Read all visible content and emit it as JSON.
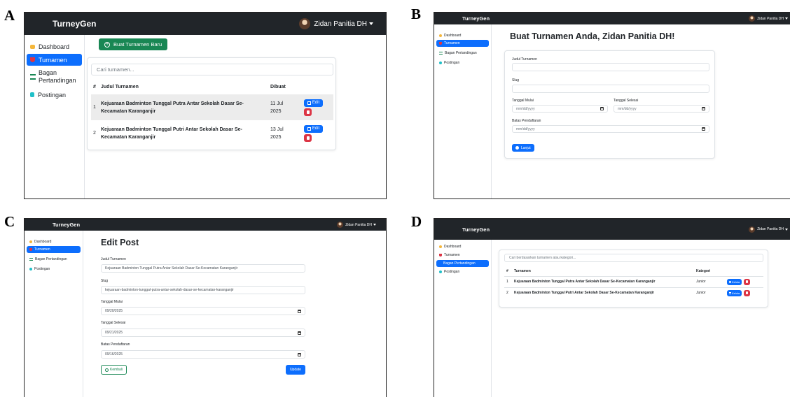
{
  "panel_labels": [
    "A",
    "B",
    "C",
    "D"
  ],
  "app": {
    "brand": "TurneyGen",
    "user_name": "Zidan Panitia DH"
  },
  "sidebar": {
    "dashboard": "Dashboard",
    "turnamen": "Turnamen",
    "bagan": "Bagan Pertandingan",
    "bagan_line1": "Bagan",
    "bagan_line2": "Pertandingan",
    "postingan": "Postingan"
  },
  "panel_a": {
    "new_button": "Buat Turnamen Baru",
    "search_placeholder": "Cari turnamen...",
    "columns": {
      "num": "#",
      "title": "Judul Turnamen",
      "created": "Dibuat"
    },
    "rows": [
      {
        "num": "1",
        "title": "Kejuaraan Badminton Tunggal Putra Antar Sekolah Dasar Se-Kecamatan Karanganjir",
        "date_line1": "11 Jul",
        "date_line2": "2025",
        "edit": "Edit"
      },
      {
        "num": "2",
        "title": "Kejuaraan Badminton Tunggal Putri Antar Sekolah Dasar Se-Kecamatan Karanganjir",
        "date_line1": "13 Jul",
        "date_line2": "2025",
        "edit": "Edit"
      }
    ]
  },
  "panel_b": {
    "heading": "Buat Turnamen Anda, Zidan Panitia DH!",
    "label_title": "Judul Turnamen",
    "label_slug": "Slug",
    "label_start": "Tanggal Mulai",
    "label_end": "Tanggal Selesai",
    "label_deadline": "Batas Pendaftaran",
    "date_placeholder": "mm/dd/yyyy",
    "next_button": "Lanjut"
  },
  "panel_c": {
    "heading": "Edit Post",
    "label_title": "Judul Turnamen",
    "value_title": "Kejuaraan Badminton Tunggal Putra Antar Sekolah Dasar Se-Kecamatan Karanganjir",
    "label_slug": "Slug",
    "value_slug": "kejuaraan-badminton-tunggal-putra-antar-sekolah-dasar-se-kecamatan-karanganjir",
    "label_start": "Tanggal Mulai",
    "value_start": "09/20/2025",
    "label_end": "Tanggal Selesai",
    "value_end": "09/21/2025",
    "label_deadline": "Batas Pendaftaran",
    "value_deadline": "09/16/2025",
    "back_button": "Kembali",
    "update_button": "Update"
  },
  "panel_d": {
    "search_placeholder": "Cari berdasarkan turnamen atau kategori...",
    "columns": {
      "num": "#",
      "title": "Turnamen",
      "category": "Kategori"
    },
    "rows": [
      {
        "num": "1",
        "title": "Kejuaraan Badminton Tunggal Putra Antar Sekolah Dasar Se-Kecamatan Karanganjir",
        "category": "Junior",
        "action": "Kelola"
      },
      {
        "num": "2",
        "title": "Kejuaraan Badminton Tunggal Putri Antar Sekolah Dasar Se-Kecamatan Karanganjir",
        "category": "Junior",
        "action": "Kelola"
      }
    ]
  }
}
